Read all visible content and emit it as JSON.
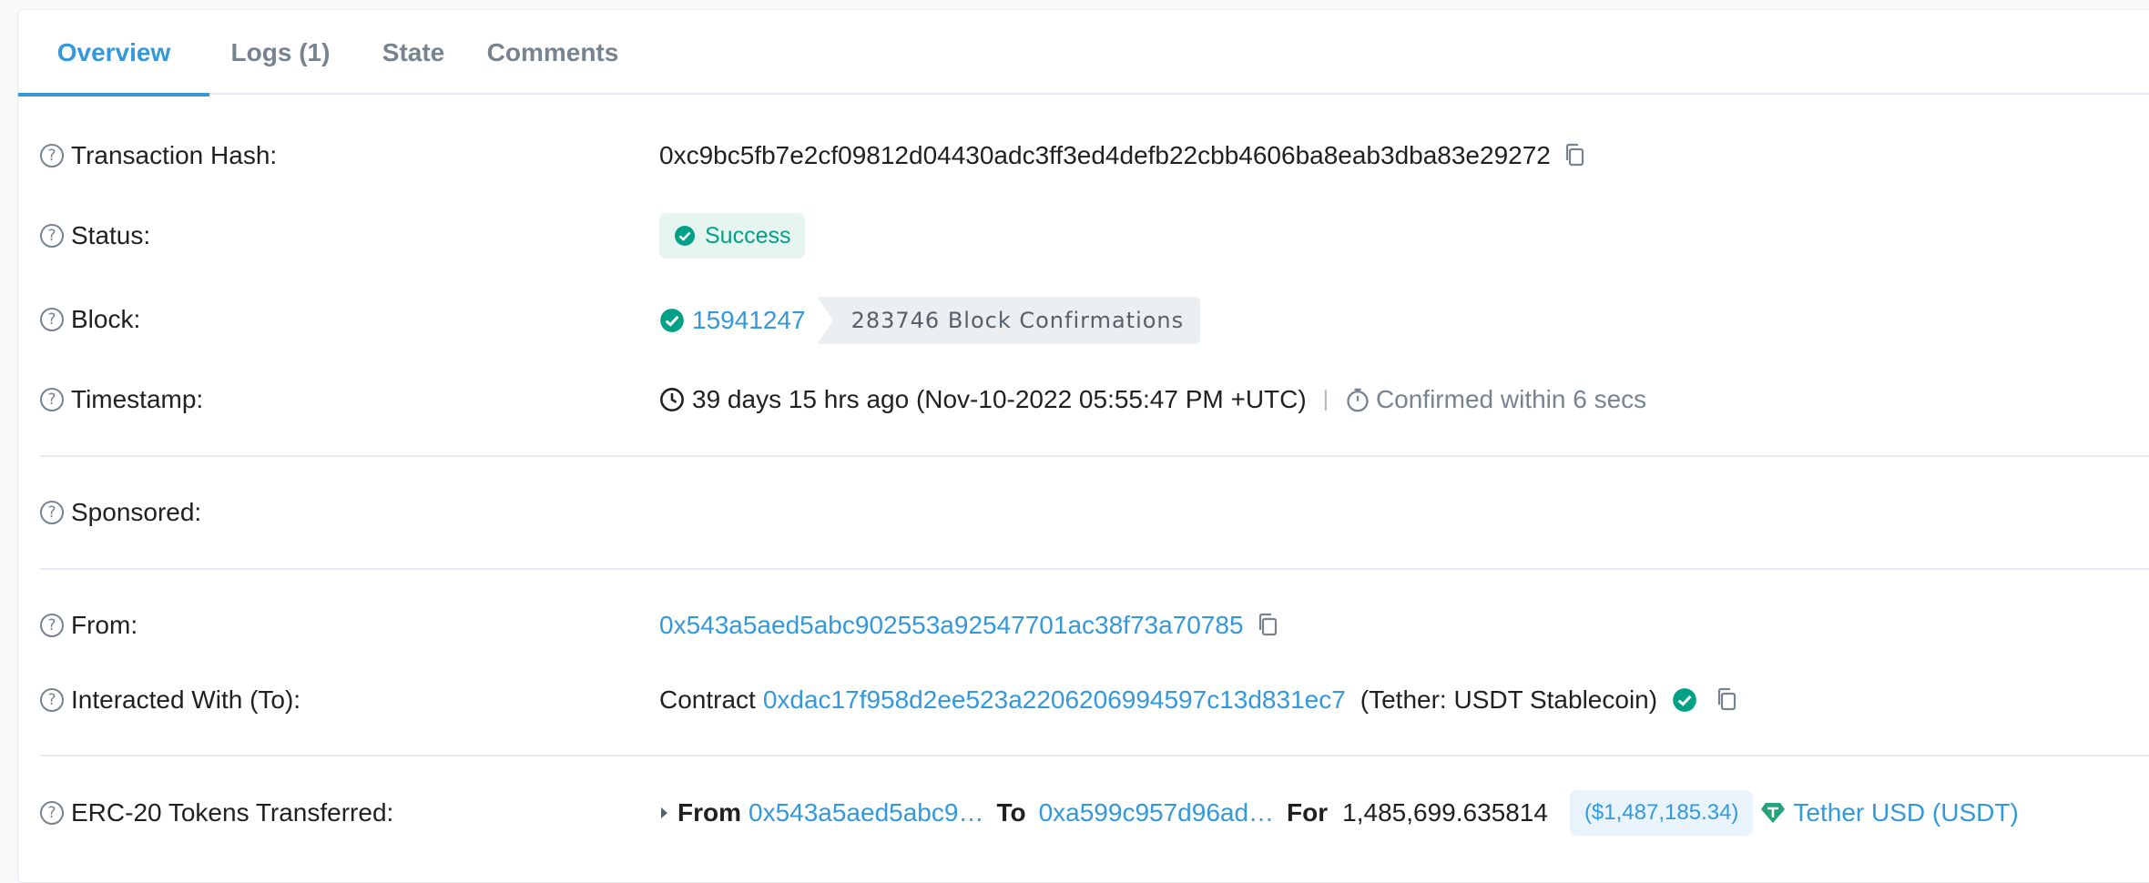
{
  "tabs": [
    {
      "label": "Overview"
    },
    {
      "label": "Logs (1)"
    },
    {
      "label": "State"
    },
    {
      "label": "Comments"
    }
  ],
  "rows": {
    "tx_hash": {
      "label": "Transaction Hash:",
      "value": "0xc9bc5fb7e2cf09812d04430adc3ff3ed4defb22cbb4606ba8eab3dba83e29272"
    },
    "status": {
      "label": "Status:",
      "value": "Success"
    },
    "block": {
      "label": "Block:",
      "number": "15941247",
      "confirmations": "283746 Block Confirmations"
    },
    "timestamp": {
      "label": "Timestamp:",
      "value": "39 days 15 hrs ago (Nov-10-2022 05:55:47 PM +UTC)",
      "separator": "|",
      "confirmed": "Confirmed within 6 secs"
    },
    "sponsored": {
      "label": "Sponsored:"
    },
    "from": {
      "label": "From:",
      "address": "0x543a5aed5abc902553a92547701ac38f73a70785"
    },
    "to": {
      "label": "Interacted With (To):",
      "prefix": "Contract",
      "address": "0xdac17f958d2ee523a2206206994597c13d831ec7",
      "name": "(Tether: USDT Stablecoin)"
    },
    "erc20": {
      "label": "ERC-20 Tokens Transferred:",
      "from_label": "From",
      "from_addr": "0x543a5aed5abc9…",
      "to_label": "To",
      "to_addr": "0xa599c957d96ad…",
      "for_label": "For",
      "amount": "1,485,699.635814",
      "usd": "($1,487,185.34)",
      "token": "Tether USD (USDT)"
    }
  },
  "colors": {
    "accent": "#3498db",
    "success": "#00a186",
    "text": "#1e2022",
    "muted": "#77838f"
  }
}
